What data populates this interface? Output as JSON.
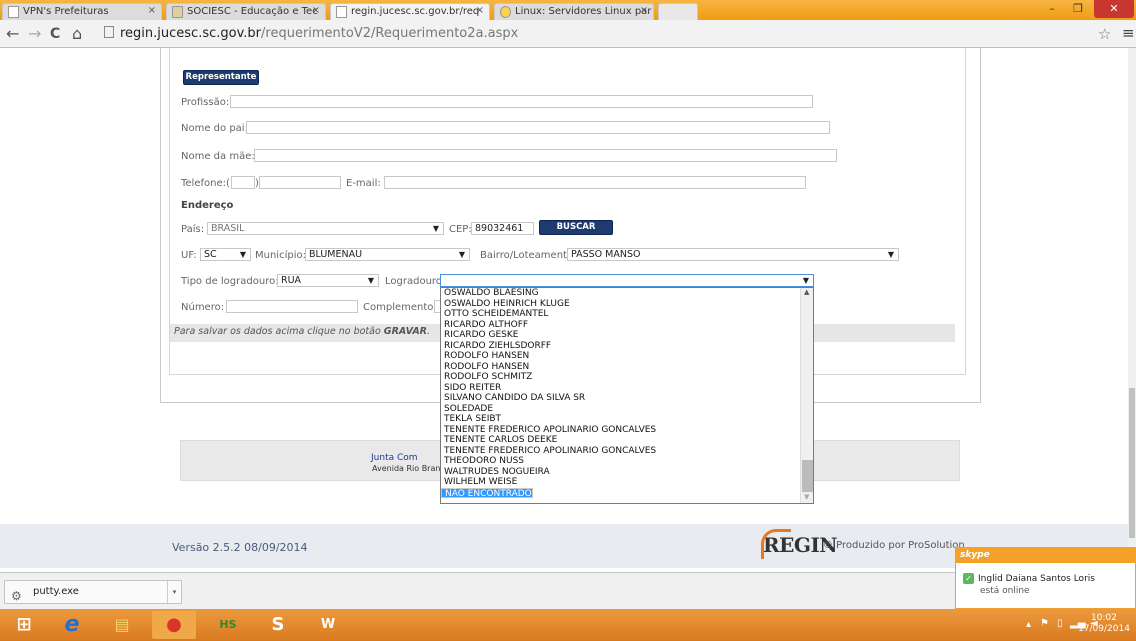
{
  "browser": {
    "tabs": [
      {
        "title": "VPN's Prefeituras",
        "active": false
      },
      {
        "title": "SOCIESC - Educação e Tec",
        "active": false
      },
      {
        "title": "regin.jucesc.sc.gov.br/req",
        "active": true
      },
      {
        "title": "Linux: Servidores Linux par",
        "active": false
      }
    ],
    "url_host": "regin.jucesc.sc.gov.br",
    "url_path": "/requerimentoV2/Requerimento2a.aspx",
    "minimize": "–",
    "restore": "❐",
    "close": "✕",
    "back": "←",
    "forward": "→",
    "reload": "C",
    "home": "⌂",
    "star": "☆",
    "menu": "≡"
  },
  "form": {
    "representante_button": "Representante",
    "profissao_label": "Profissão:",
    "profissao_value": "",
    "pai_label": "Nome do pai:",
    "pai_value": "",
    "mae_label": "Nome da mãe:",
    "mae_value": "",
    "telefone_label": "Telefone:(",
    "telefone_close": ")",
    "email_label": "E-mail:",
    "endereco_heading": "Endereço",
    "pais_label": "País:",
    "pais_value": "BRASIL",
    "cep_label": "CEP:",
    "cep_value": "89032461",
    "buscar_button": "BUSCAR",
    "uf_label": "UF:",
    "uf_value": "SC",
    "municipio_label": "Município:",
    "municipio_value": "BLUMENAU",
    "bairro_label": "Bairro/Loteamento",
    "bairro_value": "PASSO MANSO",
    "tipo_label": "Tipo de logradouro:",
    "tipo_value": "RUA",
    "logradouro_label": "Logradouro:",
    "logradouro_value": "",
    "numero_label": "Número:",
    "complemento_label": "Complemento:",
    "note_prefix": "Para salvar os dados acima clique no botão ",
    "note_bold": "GRAVAR",
    "note_suffix": "."
  },
  "dropdown": {
    "items": [
      "OSWALDO BLAESING",
      "OSWALDO HEINRICH KLUGE",
      "OTTO SCHEIDEMANTEL",
      "RICARDO ALTHOFF",
      "RICARDO GESKE",
      "RICARDO ZIEHLSDORFF",
      "RODOLFO HANSEN",
      "RODOLFO HANSEN",
      "RODOLFO SCHMITZ",
      "SIDO REITER",
      "SILVANO CANDIDO DA SILVA SR",
      "SOLEDADE",
      "TEKLA SEIBT",
      "TENENTE FREDERICO APOLINARIO GONCALVES",
      "TENENTE CARLOS DEEKE",
      "TENENTE FREDERICO APOLINARIO GONCALVES",
      "THEODORO NUSS",
      "WALTRUDES NOGUEIRA",
      "WILHELM WEISE",
      "NÃO ENCONTRADO"
    ],
    "selected": "NÃO ENCONTRADO"
  },
  "footer": {
    "junta": "Junta Com",
    "address": "Avenida Rio Bran",
    "version": "Versão 2.5.2 08/09/2014",
    "regin_logo": "REGIN",
    "produzido": "© Produzido por ProSolution"
  },
  "downloads": {
    "file": "putty.exe"
  },
  "skype": {
    "brand": "skype",
    "name": "Inglid Daiana Santos Loris",
    "status": "está online"
  },
  "taskbar": {
    "time": "10:02",
    "date": "17/09/2014"
  }
}
